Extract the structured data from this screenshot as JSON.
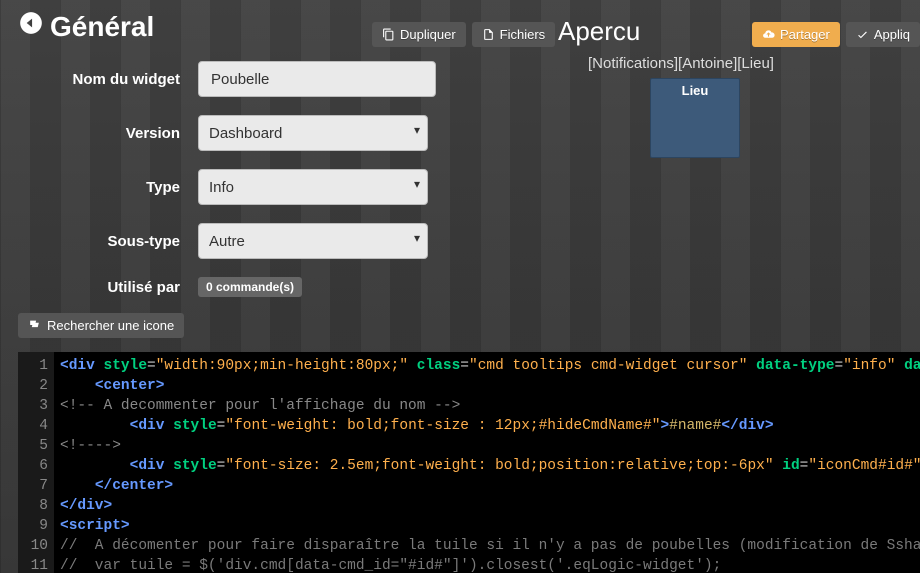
{
  "header": {
    "title": "Général",
    "duplicate_label": "Dupliquer",
    "files_label": "Fichiers"
  },
  "form": {
    "name_label": "Nom du widget",
    "name_value": "Poubelle",
    "version_label": "Version",
    "version_value": "Dashboard",
    "type_label": "Type",
    "type_value": "Info",
    "subtype_label": "Sous-type",
    "subtype_value": "Autre",
    "usedby_label": "Utilisé par",
    "usedby_badge": "0 commande(s)"
  },
  "search_icon_label": "Rechercher une icone",
  "preview": {
    "title": "Apercu",
    "share_label": "Partager",
    "apply_label": "Appliq",
    "breadcrumb": [
      "[Notifications]",
      "[Antoine]",
      "[Lieu]"
    ],
    "tile_title": "Lieu"
  },
  "code": {
    "lines": [
      [
        [
          "tag",
          "<div"
        ],
        [
          "sp",
          " "
        ],
        [
          "attr",
          "style"
        ],
        [
          "op",
          "="
        ],
        [
          "str",
          "\"width:90px;min-height:80px;\""
        ],
        [
          "sp",
          " "
        ],
        [
          "attr",
          "class"
        ],
        [
          "op",
          "="
        ],
        [
          "str",
          "\"cmd tooltips cmd-widget cursor\""
        ],
        [
          "sp",
          " "
        ],
        [
          "attr",
          "data-type"
        ],
        [
          "op",
          "="
        ],
        [
          "str",
          "\"info\""
        ],
        [
          "sp",
          " "
        ],
        [
          "attr",
          "data-"
        ]
      ],
      [
        [
          "sp",
          "    "
        ],
        [
          "tag",
          "<center>"
        ]
      ],
      [
        [
          "com",
          "<!-- A decommenter pour l'affichage du nom -->"
        ]
      ],
      [
        [
          "sp",
          "        "
        ],
        [
          "tag",
          "<div"
        ],
        [
          "sp",
          " "
        ],
        [
          "attr",
          "style"
        ],
        [
          "op",
          "="
        ],
        [
          "str",
          "\"font-weight: bold;font-size : 12px;#hideCmdName#\""
        ],
        [
          "tag",
          ">"
        ],
        [
          "txt",
          "#name#"
        ],
        [
          "tag",
          "</div>"
        ]
      ],
      [
        [
          "com",
          "<!---->"
        ]
      ],
      [
        [
          "sp",
          "        "
        ],
        [
          "tag",
          "<div"
        ],
        [
          "sp",
          " "
        ],
        [
          "attr",
          "style"
        ],
        [
          "op",
          "="
        ],
        [
          "str",
          "\"font-size: 2.5em;font-weight: bold;position:relative;top:-6px\""
        ],
        [
          "sp",
          " "
        ],
        [
          "attr",
          "id"
        ],
        [
          "op",
          "="
        ],
        [
          "str",
          "\"iconCmd#id#\""
        ],
        [
          "tag",
          ">"
        ]
      ],
      [
        [
          "sp",
          "    "
        ],
        [
          "tag",
          "</center>"
        ]
      ],
      [
        [
          "tag",
          "</div>"
        ]
      ],
      [
        [
          "tag",
          "<script>"
        ]
      ],
      [
        [
          "com2",
          "//  A décomenter pour faire disparaître la tuile si il n'y a pas de poubelles (modification de Sshafi"
        ]
      ],
      [
        [
          "com2",
          "//  var tuile = $('div.cmd[data-cmd_id=\"#id#\"]').closest('.eqLogic-widget');"
        ]
      ]
    ]
  }
}
